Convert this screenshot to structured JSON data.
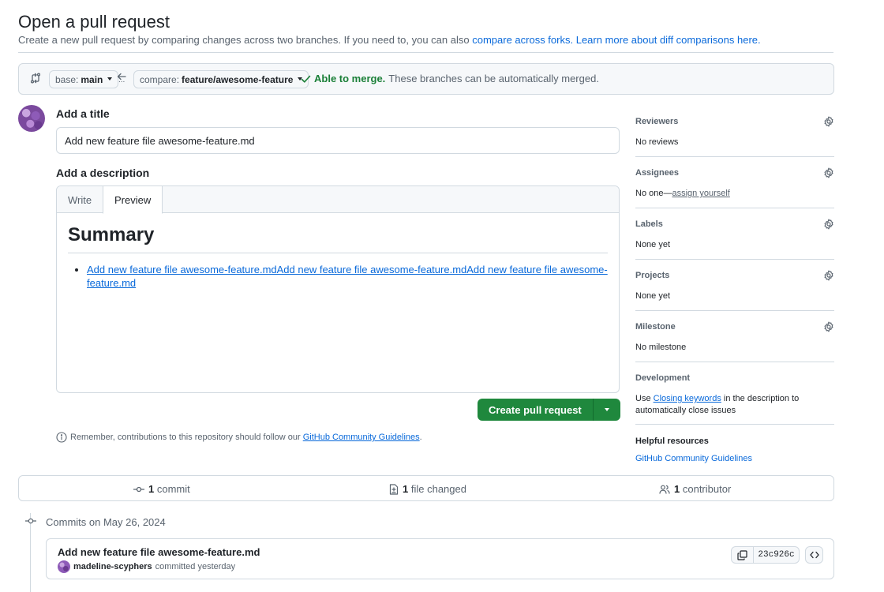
{
  "header": {
    "title": "Open a pull request",
    "subtitle_text": "Create a new pull request by comparing changes across two branches. If you need to, you can also ",
    "compare_forks_link": "compare across forks.",
    "learn_more_link": "Learn more about diff comparisons here."
  },
  "compare": {
    "base_prefix": "base:",
    "base_branch": "main",
    "compare_prefix": "compare:",
    "compare_branch": "feature/awesome-feature",
    "status_ok": "Able to merge.",
    "status_rest": "These branches can be automatically merged.",
    "dots": "..."
  },
  "form": {
    "title_label": "Add a title",
    "title_value": "Add new feature file awesome-feature.md",
    "description_label": "Add a description",
    "tabs": [
      "Write",
      "Preview"
    ],
    "active_tab": "Preview",
    "preview_heading": "Summary",
    "preview_items": [
      "Add new feature file awesome-feature.mdAdd new feature file awesome-feature.mdAdd new feature file awesome-feature.md"
    ],
    "create_button": "Create pull request",
    "remember_text": "Remember, contributions to this repository should follow our ",
    "remember_link": "GitHub Community Guidelines",
    "remember_end": "."
  },
  "sidebar": {
    "reviewers": {
      "label": "Reviewers",
      "value": "No reviews"
    },
    "assignees": {
      "label": "Assignees",
      "value": "No one—",
      "link": "assign yourself"
    },
    "labels": {
      "label": "Labels",
      "value": "None yet"
    },
    "projects": {
      "label": "Projects",
      "value": "None yet"
    },
    "milestone": {
      "label": "Milestone",
      "value": "No milestone"
    },
    "development": {
      "label": "Development",
      "text_a": "Use ",
      "link": "Closing keywords",
      "text_b": " in the description to",
      "text_c": "automatically close issues"
    },
    "helpful": {
      "label": "Helpful resources",
      "link": "GitHub Community Guidelines"
    }
  },
  "stats": {
    "commits_count": "1",
    "commits_label": "commit",
    "files_count": "1",
    "files_label": "file changed",
    "contributors_count": "1",
    "contributors_label": "contributor"
  },
  "commits": {
    "date_heading": "Commits on May 26, 2024",
    "items": [
      {
        "message": "Add new feature file awesome-feature.md",
        "author": "madeline-scyphers",
        "when": "committed yesterday",
        "sha": "23c926c"
      }
    ]
  },
  "colors": {
    "accent": "#0969da",
    "success": "#1a7f37",
    "button_green": "#1f883d"
  }
}
